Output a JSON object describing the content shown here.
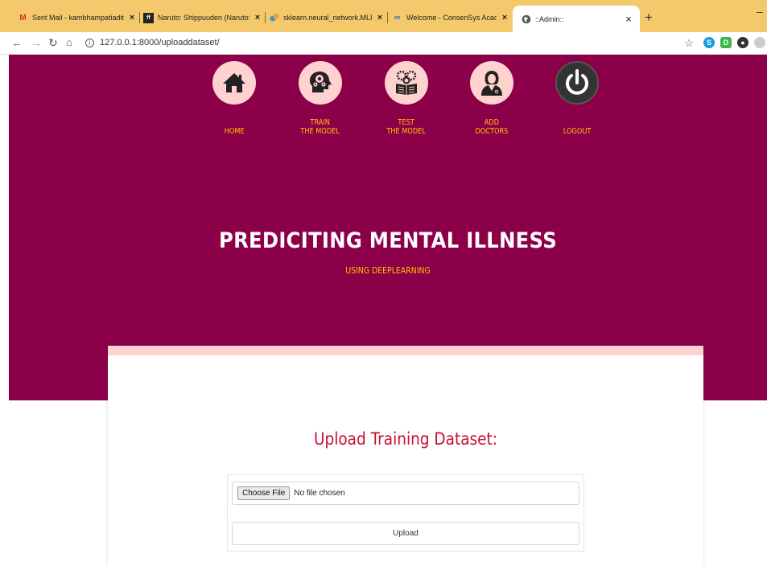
{
  "browser": {
    "tabs": [
      {
        "title": "Sent Mail - kambhampatiadityal",
        "favicon": "gmail-icon"
      },
      {
        "title": "Naruto: Shippuuden (Naruto: Shi",
        "favicon": "anime-icon"
      },
      {
        "title": "sklearn.neural_network.MLPClass",
        "favicon": "sklearn-icon"
      },
      {
        "title": "Welcome - ConsenSys Academy",
        "favicon": "consensys-icon"
      },
      {
        "title": "::Admin::",
        "favicon": "globe-icon",
        "active": true
      }
    ],
    "new_tab": "+",
    "close": "×",
    "url": "127.0.0.1:8000/uploaddataset/"
  },
  "nav": {
    "items": [
      {
        "label_line1": "",
        "label_line2": "HOME",
        "icon": "home-icon"
      },
      {
        "label_line1": "TRAIN",
        "label_line2": "THE MODEL",
        "icon": "brain-gears-icon"
      },
      {
        "label_line1": "TEST",
        "label_line2": "THE MODEL",
        "icon": "book-gears-icon"
      },
      {
        "label_line1": "ADD",
        "label_line2": "DOCTORS",
        "icon": "doctor-icon"
      },
      {
        "label_line1": "",
        "label_line2": "LOGOUT",
        "icon": "power-icon"
      }
    ]
  },
  "hero": {
    "title": "PREDICITING MENTAL ILLNESS",
    "subtitle": "USING DEEPLEARNING"
  },
  "form": {
    "title": "Upload Training Dataset:",
    "choose_file": "Choose File",
    "no_file": "No file chosen",
    "upload": "Upload"
  },
  "colors": {
    "hero_bg": "#8b0048",
    "accent_yellow": "#ffc400",
    "circle_pink": "#ffd1cf",
    "title_red": "#c6102e",
    "tabbar": "#f3c96c"
  }
}
